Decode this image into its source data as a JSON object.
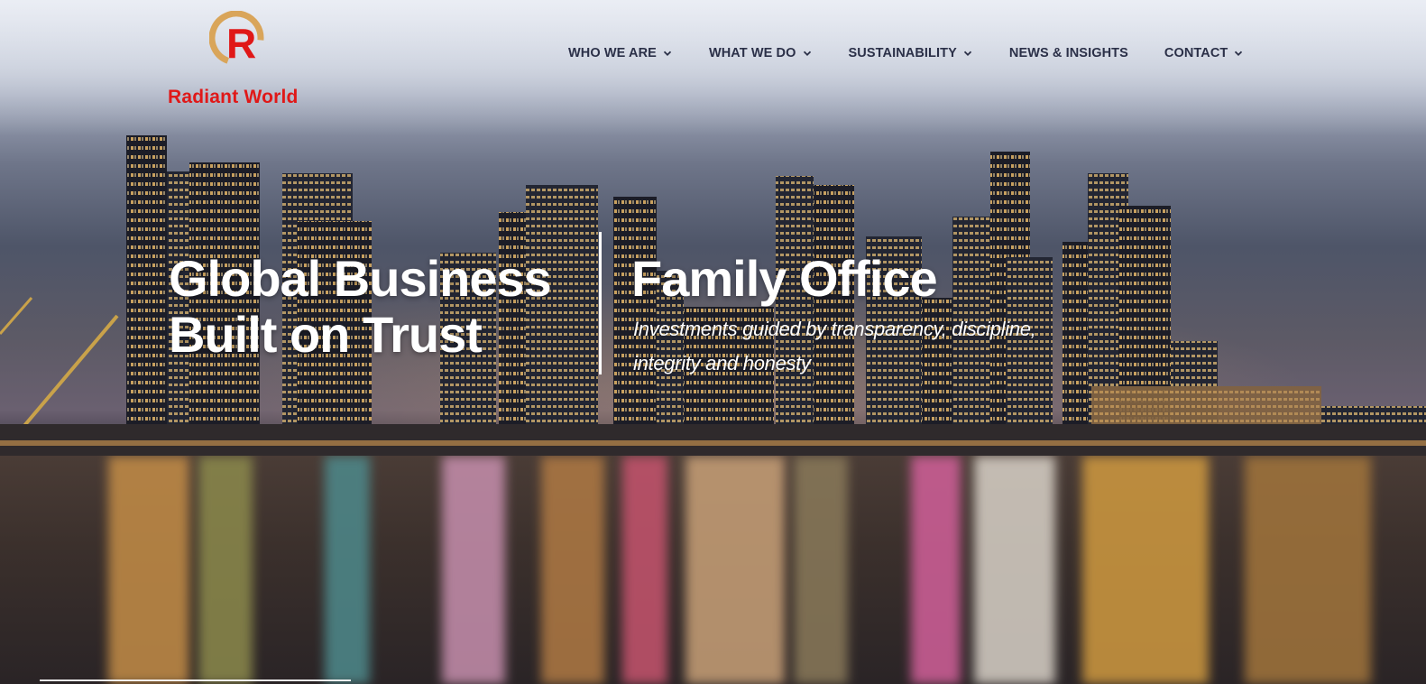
{
  "brand": {
    "name": "Radiant World",
    "logo_letter": "R",
    "colors": {
      "red": "#e01818",
      "gold": "#d9a55a"
    }
  },
  "nav": {
    "items": [
      {
        "label": "WHO WE ARE",
        "dropdown": true
      },
      {
        "label": "WHAT WE DO",
        "dropdown": true
      },
      {
        "label": "SUSTAINABILITY",
        "dropdown": true
      },
      {
        "label": "NEWS & INSIGHTS",
        "dropdown": false
      },
      {
        "label": "CONTACT",
        "dropdown": true
      }
    ],
    "text_color": "#2b3048"
  },
  "hero": {
    "headline_line1": "Global Business",
    "headline_line2": "Built on Trust",
    "family_office_title": "Family Office",
    "family_office_subtitle": "Investments guided by transparency, discipline, integrity and honesty"
  }
}
